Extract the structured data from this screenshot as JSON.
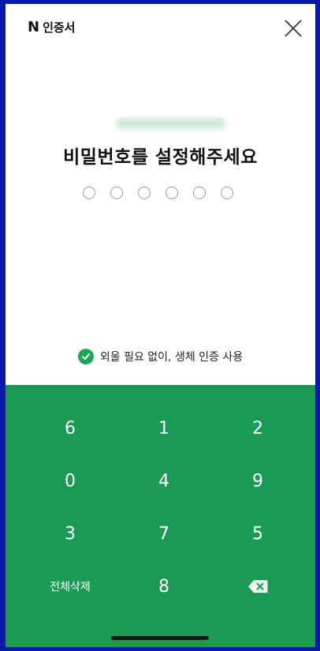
{
  "header": {
    "brand_letter": "N",
    "brand_text": "인증서"
  },
  "title": "비밀번호를 설정해주세요",
  "pin": {
    "length": 6,
    "entered": 0
  },
  "biometric": {
    "checked": true,
    "label": "외울 필요 없이, 생체 인증 사용"
  },
  "keypad": {
    "rows": [
      [
        "6",
        "1",
        "2"
      ],
      [
        "0",
        "4",
        "9"
      ],
      [
        "3",
        "7",
        "5"
      ]
    ],
    "last_row": {
      "clear_all": "전체삭제",
      "digit": "8",
      "backspace_icon": "backspace-icon"
    }
  },
  "colors": {
    "keypad_bg": "#1b9a56",
    "accent": "#1fa559",
    "frame": "#0a1aa6"
  }
}
